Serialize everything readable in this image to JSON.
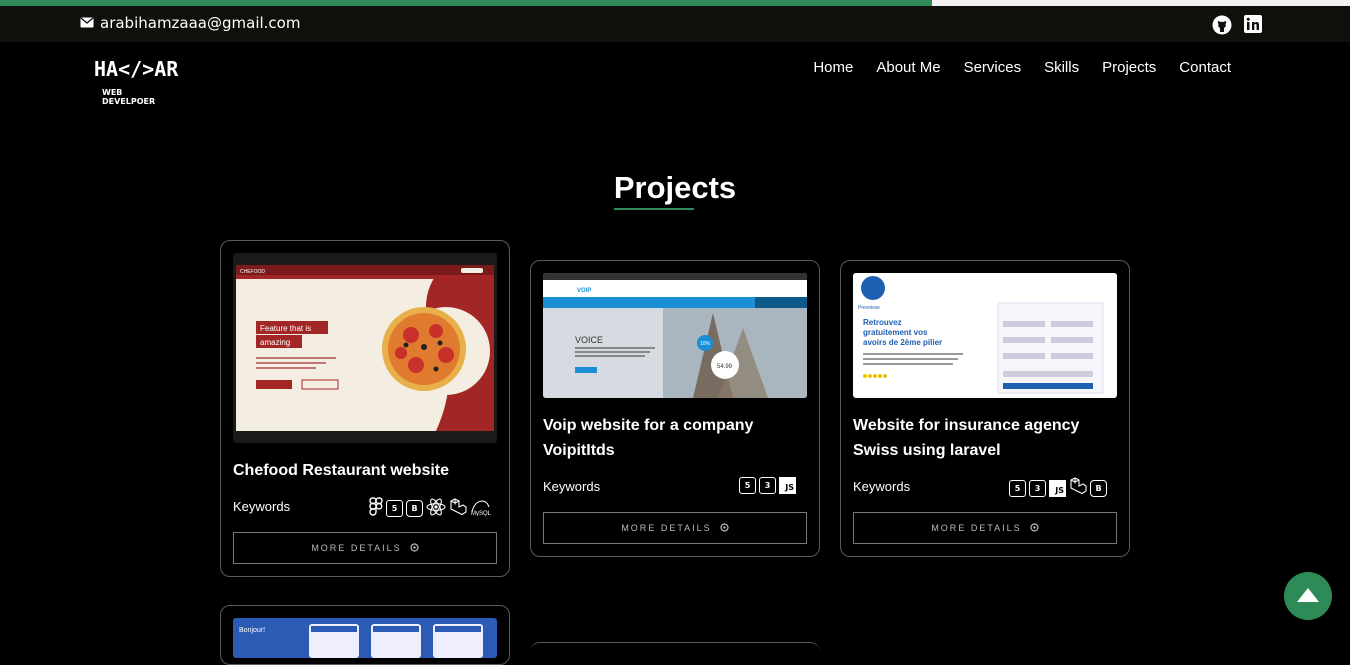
{
  "scroll_progress_percent": 69,
  "topbar": {
    "email": "arabihamzaaa@gmail.com",
    "social_icons": [
      "github-icon",
      "linkedin-icon"
    ]
  },
  "logo": {
    "line1": "HA</>AR",
    "line2": "WEB DEVELPOER"
  },
  "nav": [
    "Home",
    "About Me",
    "Services",
    "Skills",
    "Projects",
    "Contact"
  ],
  "section": {
    "title": "Projects"
  },
  "cards": [
    {
      "title": "Chefood Restaurant website",
      "keywords_label": "Keywords",
      "more": "MORE DETAILS",
      "tech": [
        "figma",
        "html5",
        "bootstrap",
        "react",
        "laravel",
        "mysql"
      ],
      "thumb": {
        "brand": "CHEFOOD",
        "headline1": "Feature that is",
        "headline2": "amazing"
      }
    },
    {
      "title": "Voip website for a company VoipitItds",
      "keywords_label": "Keywords",
      "more": "MORE DETAILS",
      "tech": [
        "html5",
        "css3",
        "js"
      ],
      "thumb": {
        "brand": "VOIP",
        "headline": "VOICE",
        "price": "54.99",
        "badge": "10%"
      }
    },
    {
      "title": "Website for insurance agency Swiss using laravel",
      "keywords_label": "Keywords",
      "more": "MORE DETAILS",
      "tech": [
        "html5",
        "css3",
        "js",
        "laravel",
        "bootstrap"
      ],
      "thumb": {
        "brand": "Prevoisse",
        "headline1": "Retrouvez",
        "headline2": "gratuitement vos",
        "headline3": "avoirs de 2ème pilier"
      }
    },
    {
      "thumb": {
        "headline": "Bonjour!"
      }
    }
  ],
  "colors": {
    "accent": "#2e8b57",
    "card_border": "#5a5a5a",
    "chefood_red": "#a32626",
    "voip_blue": "#1a8fd6",
    "insure_blue": "#1d5fb0"
  }
}
